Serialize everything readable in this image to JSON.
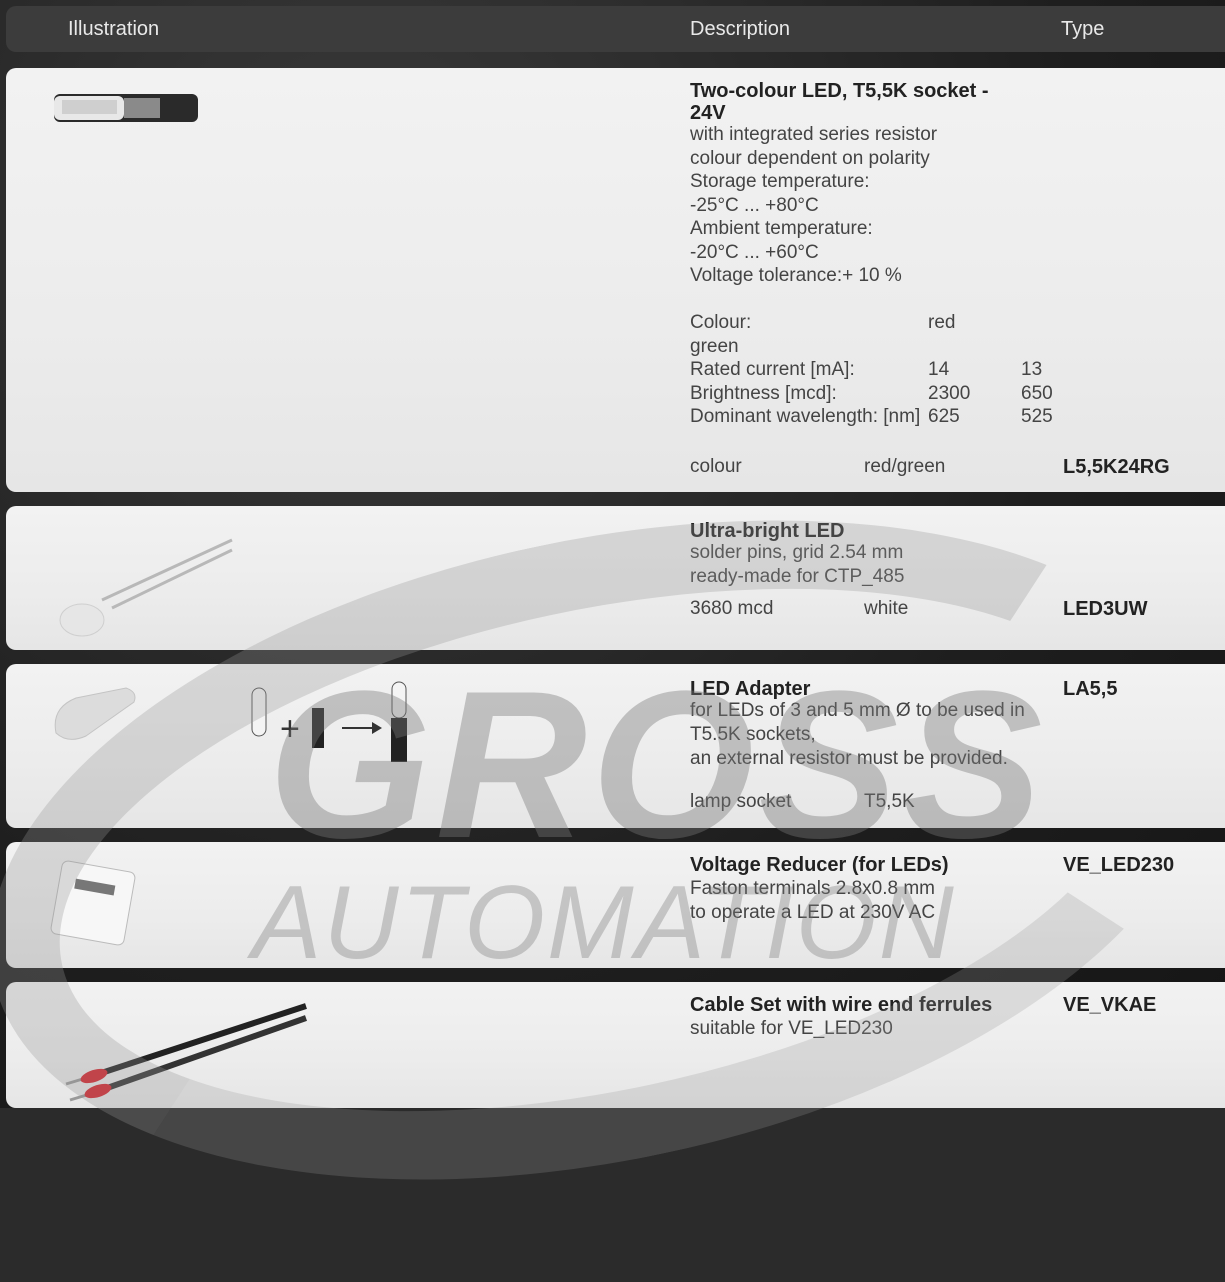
{
  "header": {
    "illustration": "Illustration",
    "description": "Description",
    "type": "Type"
  },
  "products": [
    {
      "title_1": "Two-colour LED, T5,5K socket -",
      "title_2": "24V",
      "lines": [
        "with integrated series resistor",
        "colour dependent on polarity",
        "Storage temperature:",
        "-25°C ... +80°C",
        "Ambient temperature:",
        "-20°C ... +60°C",
        "Voltage tolerance:+ 10 %"
      ],
      "spec": {
        "colour_label": "Colour:",
        "colour_value": "red",
        "colour_cont": "green",
        "current_label": "Rated current [mA]:",
        "current_red": "14",
        "current_green": "13",
        "brightness_label": "Brightness [mcd]:",
        "brightness_red": "2300",
        "brightness_green": "650",
        "wavelength_label": "Dominant wavelength: [nm]",
        "wavelength_red": "625",
        "wavelength_green": "525"
      },
      "variant_label": "colour",
      "variant_value": "red/green",
      "type": "L5,5K24RG"
    },
    {
      "title": "Ultra-bright LED",
      "lines": [
        "solder pins, grid 2.54 mm",
        "ready-made for CTP_485"
      ],
      "variant_label": "3680 mcd",
      "variant_value": "white",
      "type": "LED3UW"
    },
    {
      "title": "LED Adapter",
      "lines": [
        "for LEDs of 3 and 5 mm Ø to be used in",
        "T5.5K sockets,",
        "an external resistor must be provided."
      ],
      "variant_label": "lamp socket",
      "variant_value": "T5,5K",
      "type": "LA5,5"
    },
    {
      "title": "Voltage Reducer (for LEDs)",
      "lines": [
        "Faston terminals 2.8x0.8 mm",
        "to operate a LED at 230V AC"
      ],
      "type": "VE_LED230"
    },
    {
      "title": "Cable Set with wire end ferrules",
      "lines": [
        "suitable for VE_LED230"
      ],
      "type": "VE_VKAE"
    }
  ],
  "watermark": {
    "line1": "GROSS",
    "line2": "AUTOMATION"
  }
}
